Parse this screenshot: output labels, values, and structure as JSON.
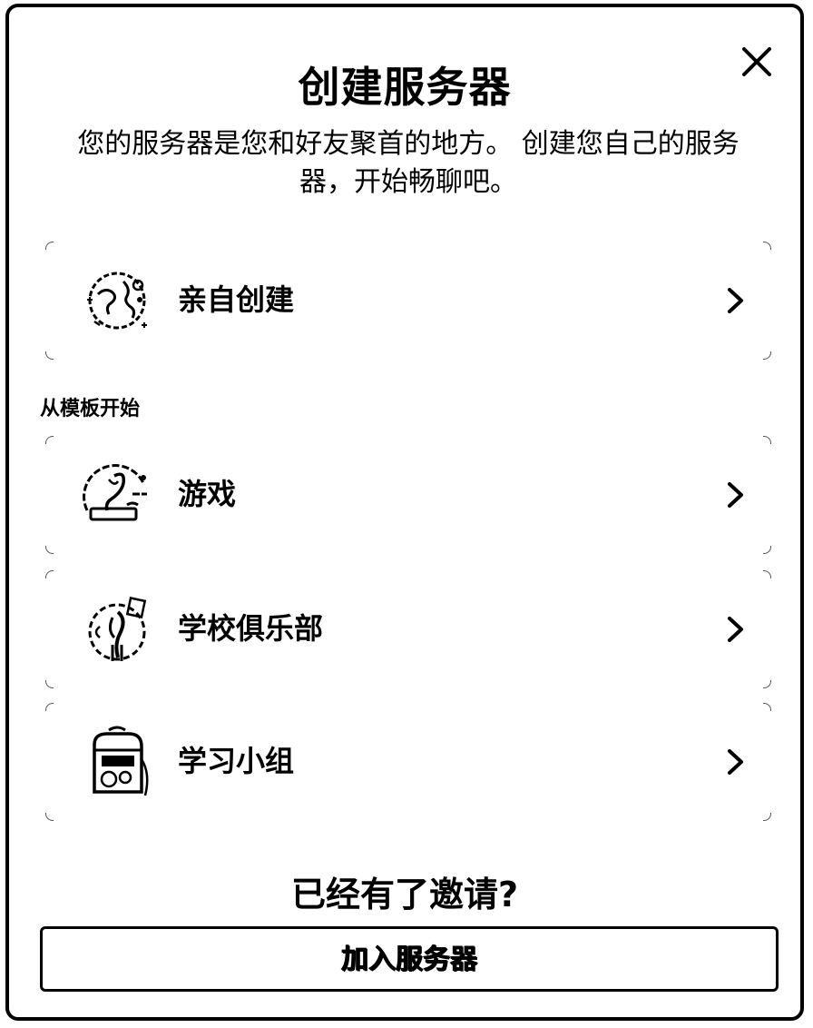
{
  "dialog": {
    "title": "创建服务器",
    "subtitle": "您的服务器是您和好友聚首的地方。 创建您自己的服务器，开始畅聊吧。",
    "close_icon": "close-icon"
  },
  "options": [
    {
      "label": "亲自创建",
      "icon": "globe-create-icon"
    },
    {
      "label": "游戏",
      "icon": "gaming-icon"
    },
    {
      "label": "学校俱乐部",
      "icon": "school-club-icon"
    },
    {
      "label": "学习小组",
      "icon": "backpack-icon"
    }
  ],
  "templates_section": {
    "label": "从模板开始"
  },
  "invite": {
    "title": "已经有了邀请?",
    "button_label": "加入服务器"
  }
}
